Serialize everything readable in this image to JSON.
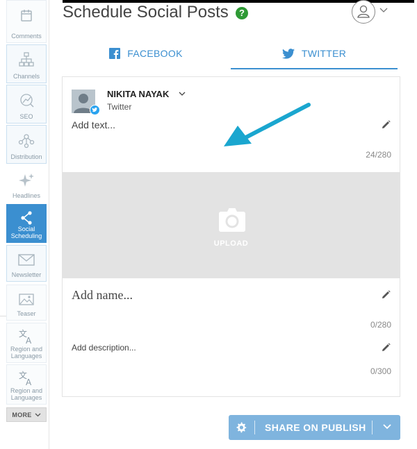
{
  "sidebar": {
    "items": [
      {
        "label": "Comments",
        "icon": "calendar-icon"
      },
      {
        "label": "Channels",
        "icon": "sitemap-icon"
      },
      {
        "label": "SEO",
        "icon": "seo-graph-icon"
      },
      {
        "label": "Distribution",
        "icon": "network-icon"
      },
      {
        "label": "Headlines",
        "icon": "sparkle-icon"
      },
      {
        "label": "Social Scheduling",
        "icon": "share-icon"
      },
      {
        "label": "Newsletter",
        "icon": "envelope-icon"
      },
      {
        "label": "Teaser",
        "icon": "image-icon"
      },
      {
        "label": "Region and Languages",
        "icon": "translate-icon"
      },
      {
        "label": "Region and Languages",
        "icon": "translate-icon"
      }
    ],
    "more_label": "MORE"
  },
  "header": {
    "title": "Schedule Social Posts",
    "help": "?"
  },
  "tabs": [
    {
      "label": "FACEBOOK"
    },
    {
      "label": "TWITTER"
    }
  ],
  "post": {
    "account_name": "NIKITA NAYAK",
    "network": "Twitter",
    "text_placeholder": "Add text...",
    "text_counter": "24/280",
    "upload_label": "UPLOAD",
    "name_placeholder": "Add name...",
    "name_counter": "0/280",
    "description_placeholder": "Add description...",
    "description_counter": "0/300"
  },
  "share_button": {
    "label": "SHARE ON PUBLISH"
  },
  "colors": {
    "accent": "#3b8fd0",
    "share_button": "#7fb4de",
    "help_badge": "#2e9a35",
    "annotation_arrow": "#1aa6cf"
  }
}
